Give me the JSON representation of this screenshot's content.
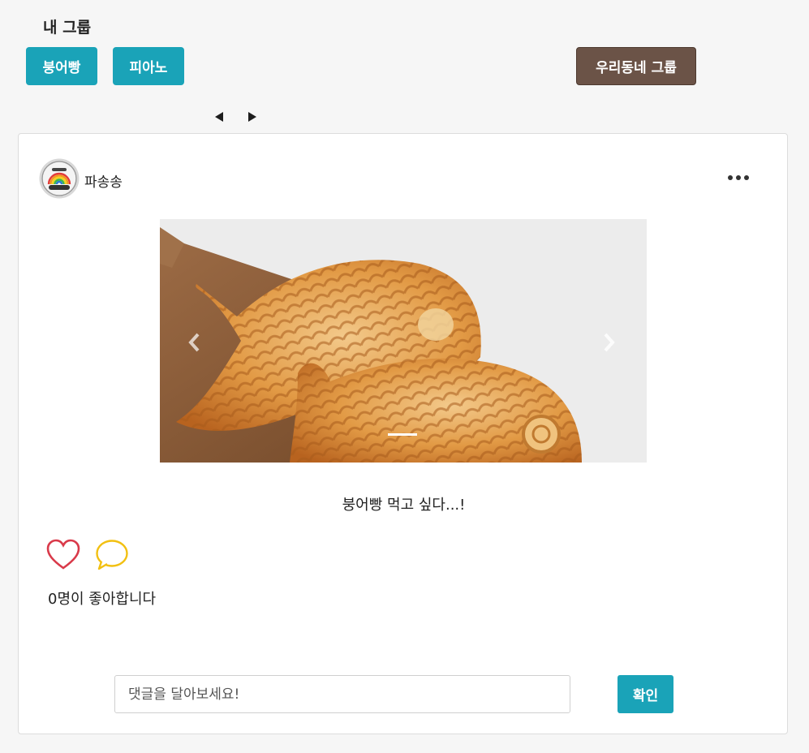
{
  "header": {
    "section_title": "내 그룹",
    "groups": [
      {
        "label": "붕어빵"
      },
      {
        "label": "피아노"
      },
      {
        "label": "우리동네 그룹"
      }
    ]
  },
  "post": {
    "author": "파송송",
    "caption": "붕어빵 먹고 싶다...!",
    "like_count_text": "0명이 좋아합니다",
    "comment_placeholder": "댓글을 달아보세요!",
    "comment_value": "",
    "confirm_label": "확인"
  },
  "colors": {
    "accent": "#1aa3b8",
    "group_highlight": "#6b5347",
    "heart": "#d93a4a",
    "comment_icon": "#f2c012"
  },
  "icons": {
    "pager_prev": "caret-left-icon",
    "pager_next": "caret-right-icon",
    "more": "more-horizontal-icon",
    "like": "heart-icon",
    "comment": "comment-bubble-icon",
    "carousel_prev": "chevron-left-icon",
    "carousel_next": "chevron-right-icon"
  }
}
